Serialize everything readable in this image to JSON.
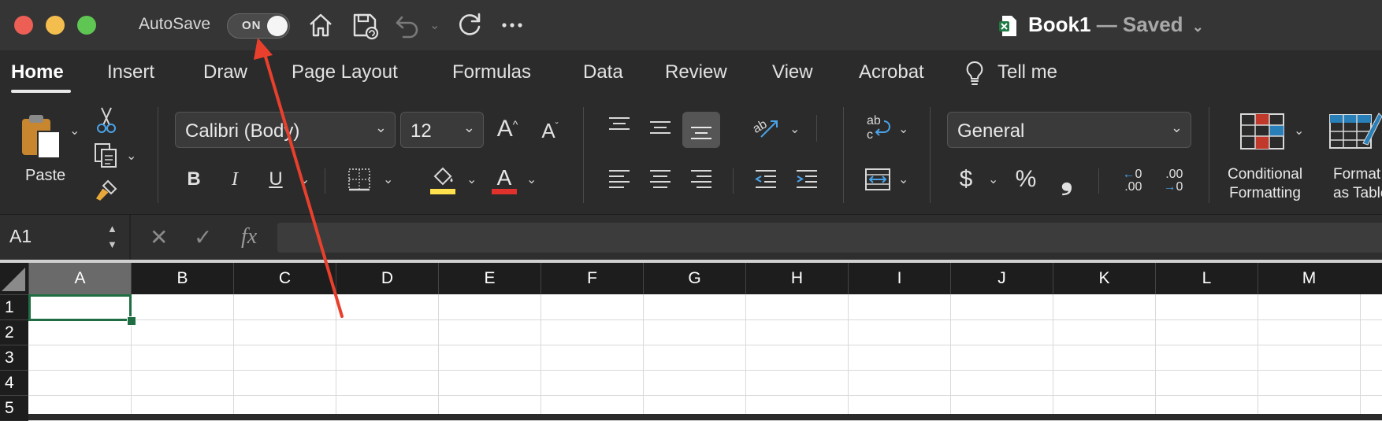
{
  "titlebar": {
    "autosave_label": "AutoSave",
    "autosave_state": "ON",
    "doc_name": "Book1",
    "doc_status": "— Saved",
    "traffic_lights": [
      "#ed5f55",
      "#f4be4f",
      "#5fc553"
    ],
    "quick_access_icons": [
      "home-icon",
      "save-icon",
      "undo-icon",
      "redo-icon",
      "more-icon"
    ]
  },
  "tabs": [
    {
      "label": "Home",
      "active": true
    },
    {
      "label": "Insert"
    },
    {
      "label": "Draw"
    },
    {
      "label": "Page Layout"
    },
    {
      "label": "Formulas"
    },
    {
      "label": "Data"
    },
    {
      "label": "Review"
    },
    {
      "label": "View"
    },
    {
      "label": "Acrobat"
    },
    {
      "label": "Tell me",
      "icon": "lightbulb-icon"
    }
  ],
  "ribbon": {
    "paste_label": "Paste",
    "font_name": "Calibri (Body)",
    "font_size": "12",
    "number_format": "General",
    "bold": "B",
    "italic": "I",
    "underline": "U",
    "currency": "$",
    "percent": "%",
    "comma": "❟",
    "increase_decimal": {
      "top": "0",
      "bottom": ".00"
    },
    "decrease_decimal": {
      "top": ".00",
      "bottom": "0"
    },
    "conditional_formatting": {
      "line1": "Conditional",
      "line2": "Formatting"
    },
    "format_as_table": {
      "line1": "Format",
      "line2": "as Table"
    },
    "fill_color": "#ffe14d",
    "font_color": "#e0312c"
  },
  "formula_bar": {
    "name_box": "A1",
    "cancel": "✕",
    "enter": "✓",
    "fx": "fx",
    "value": ""
  },
  "sheet": {
    "columns": [
      "A",
      "B",
      "C",
      "D",
      "E",
      "F",
      "G",
      "H",
      "I",
      "J",
      "K",
      "L",
      "M"
    ],
    "rows": [
      "1",
      "2",
      "3",
      "4",
      "5"
    ],
    "selected_cell": "A1"
  },
  "colors": {
    "accent_green": "#1f6e43",
    "annotation_arrow": "#e8402c"
  }
}
